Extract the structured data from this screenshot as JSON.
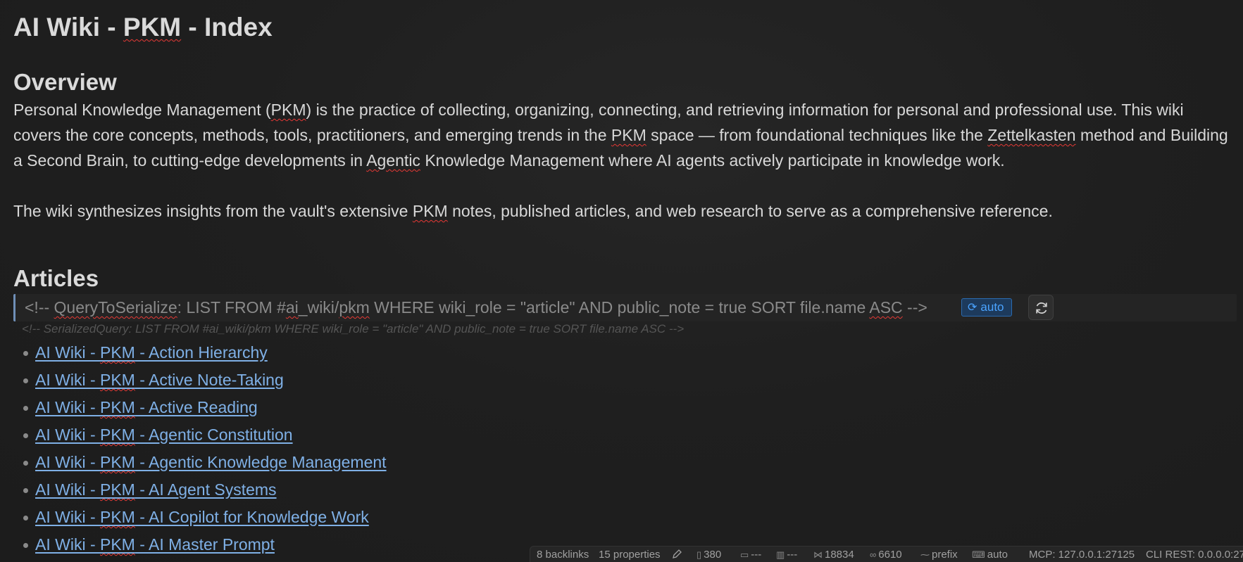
{
  "page": {
    "title_parts": [
      "AI Wiki - ",
      "PKM",
      " - Index"
    ]
  },
  "overview": {
    "heading": "Overview",
    "para1": {
      "t1": "Personal Knowledge Management (",
      "s1": "PKM",
      "t2": ") is the practice of collecting, organizing, connecting, and retrieving information for personal and professional use. This wiki covers the core concepts, methods, tools, practitioners, and emerging trends in the ",
      "s2": "PKM",
      "t3": " space — from foundational techniques like the ",
      "s3": "Zettelkasten",
      "t4": " method and Building a Second Brain, to cutting-edge developments in ",
      "s4": "Agentic",
      "t5": " Knowledge Management where AI agents actively participate in knowledge work."
    },
    "para2": {
      "t1": "The wiki synthesizes insights from the vault's extensive ",
      "s1": "PKM",
      "t2": " notes, published articles, and web research to serve as a comprehensive reference."
    }
  },
  "articles": {
    "heading": "Articles",
    "query": {
      "prefix": "<!-- ",
      "keyword": "QueryToSerialize",
      "mid1": ": LIST FROM #",
      "tag_a": "ai",
      "mid2": "_wiki/",
      "tag_b": "pkm",
      "mid3": " WHERE wiki_role = \"article\" AND public_note = true SORT file.name ",
      "asc": "ASC",
      "suffix": " -->"
    },
    "auto_badge_label": "auto",
    "auto_badge_icon": "sync-icon",
    "refresh_icon": "refresh-icon",
    "serialized_comment": "<!-- SerializedQuery: LIST FROM #ai_wiki/pkm WHERE wiki_role = \"article\" AND public_note = true SORT file.name ASC -->",
    "items": [
      {
        "pre": "AI Wiki - ",
        "pkm": "PKM",
        "post": " - Action Hierarchy"
      },
      {
        "pre": "AI Wiki - ",
        "pkm": "PKM",
        "post": " - Active Note-Taking"
      },
      {
        "pre": "AI Wiki - ",
        "pkm": "PKM",
        "post": " - Active Reading"
      },
      {
        "pre": "AI Wiki - ",
        "pkm": "PKM",
        "post": " - Agentic Constitution"
      },
      {
        "pre": "AI Wiki - ",
        "pkm": "PKM",
        "post": " - Agentic Knowledge Management"
      },
      {
        "pre": "AI Wiki - ",
        "pkm": "PKM",
        "post": " - AI Agent Systems"
      },
      {
        "pre": "AI Wiki - ",
        "pkm": "PKM",
        "post": " - AI Copilot for Knowledge Work"
      },
      {
        "pre": "AI Wiki - ",
        "pkm": "PKM",
        "post": " - AI Master Prompt"
      }
    ]
  },
  "status_bar": {
    "backlinks": "8 backlinks",
    "properties": "15 properties",
    "words": "380",
    "val_a": "---",
    "val_b": "---",
    "chars": "18834",
    "tokens": "6610",
    "prefix_label": "prefix",
    "keyboard_label": "auto",
    "mcp": "MCP: 127.0.0.1:27125",
    "cli": "CLI REST: 0.0.0.0:27"
  }
}
